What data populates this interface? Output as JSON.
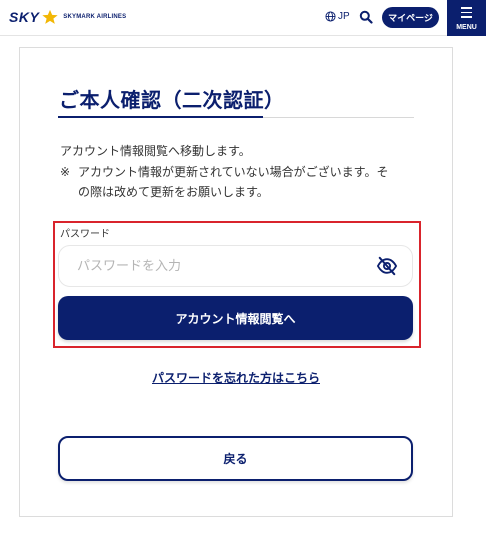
{
  "header": {
    "logo_text": "SKY",
    "logo_subtext": "SKYMARK AIRLINES",
    "language": "JP",
    "mypage_label": "マイページ",
    "menu_label": "MENU"
  },
  "page": {
    "title": "ご本人確認（二次認証）",
    "description": "アカウント情報閲覧へ移動します。",
    "note_mark": "※",
    "note_text": "アカウント情報が更新されていない場合がございます。その際は改めて更新をお願いします。"
  },
  "form": {
    "password_label": "パスワード",
    "password_value": "",
    "password_placeholder": "パスワードを入力",
    "submit_label": "アカウント情報閲覧へ",
    "forgot_link": "パスワードを忘れた方はこちら",
    "back_label": "戻る"
  },
  "colors": {
    "brand": "#0b1f6e",
    "star": "#f2b705",
    "highlight": "#d9242c"
  },
  "icons": {
    "language": "globe-icon",
    "search": "search-icon",
    "menu": "hamburger-icon",
    "visibility": "eye-slash-icon",
    "logo_star": "star-icon"
  }
}
